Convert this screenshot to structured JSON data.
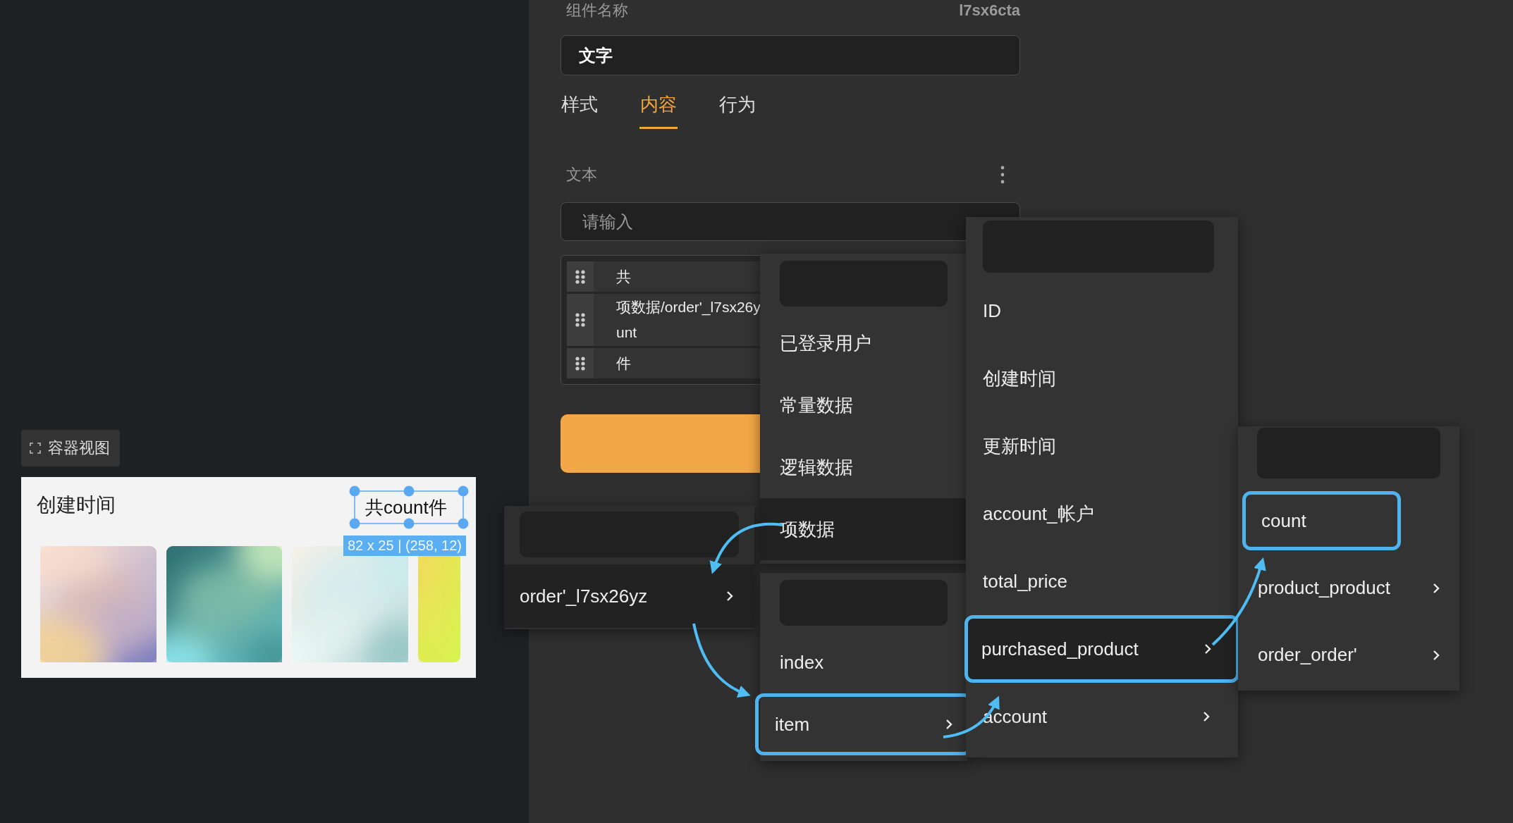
{
  "canvas": {
    "view_button": {
      "label": "容器视图"
    },
    "preview": {
      "title": "创建时间",
      "selected_text": "共count件",
      "size_label": "82 x 25 | (258, 12)"
    }
  },
  "panel": {
    "name_label": "组件名称",
    "component_id": "l7sx6cta",
    "name_value": "文字",
    "tabs": [
      {
        "label": "样式",
        "selected": false
      },
      {
        "label": "内容",
        "selected": true
      },
      {
        "label": "行为",
        "selected": false
      }
    ],
    "section_label": "文本",
    "input": {
      "placeholder": "请输入"
    },
    "tokens": [
      {
        "lines": [
          "共"
        ]
      },
      {
        "lines": [
          "项数据/order'_l7sx26y",
          "unt"
        ]
      },
      {
        "lines": [
          "件"
        ]
      }
    ]
  },
  "menus": [
    {
      "items": [
        {
          "label": "已登录用户",
          "selected": false,
          "outlined": false,
          "has_submenu": false
        },
        {
          "label": "常量数据",
          "selected": false,
          "outlined": false,
          "has_submenu": false
        },
        {
          "label": "逻辑数据",
          "selected": false,
          "outlined": false,
          "has_submenu": false
        },
        {
          "label": "项数据",
          "selected": true,
          "outlined": false,
          "has_submenu": false
        }
      ]
    },
    {
      "items": [
        {
          "label": "order'_l7sx26yz",
          "selected": true,
          "outlined": false,
          "has_submenu": true
        }
      ]
    },
    {
      "items": [
        {
          "label": "index",
          "selected": false,
          "outlined": false,
          "has_submenu": false
        },
        {
          "label": "item",
          "selected": false,
          "outlined": true,
          "has_submenu": true
        }
      ]
    },
    {
      "items": [
        {
          "label": "ID",
          "selected": false,
          "outlined": false,
          "has_submenu": false
        },
        {
          "label": "创建时间",
          "selected": false,
          "outlined": false,
          "has_submenu": false
        },
        {
          "label": "更新时间",
          "selected": false,
          "outlined": false,
          "has_submenu": false
        },
        {
          "label": "account_帐户",
          "selected": false,
          "outlined": false,
          "has_submenu": false
        },
        {
          "label": "total_price",
          "selected": false,
          "outlined": false,
          "has_submenu": false
        },
        {
          "label": "purchased_product",
          "selected": true,
          "outlined": true,
          "has_submenu": true
        },
        {
          "label": "account",
          "selected": false,
          "outlined": false,
          "has_submenu": true
        }
      ]
    },
    {
      "items": [
        {
          "label": "count",
          "selected": false,
          "outlined": true,
          "has_submenu": false
        },
        {
          "label": "product_product",
          "selected": false,
          "outlined": false,
          "has_submenu": true
        },
        {
          "label": "order_order'",
          "selected": false,
          "outlined": false,
          "has_submenu": true
        }
      ]
    }
  ]
}
